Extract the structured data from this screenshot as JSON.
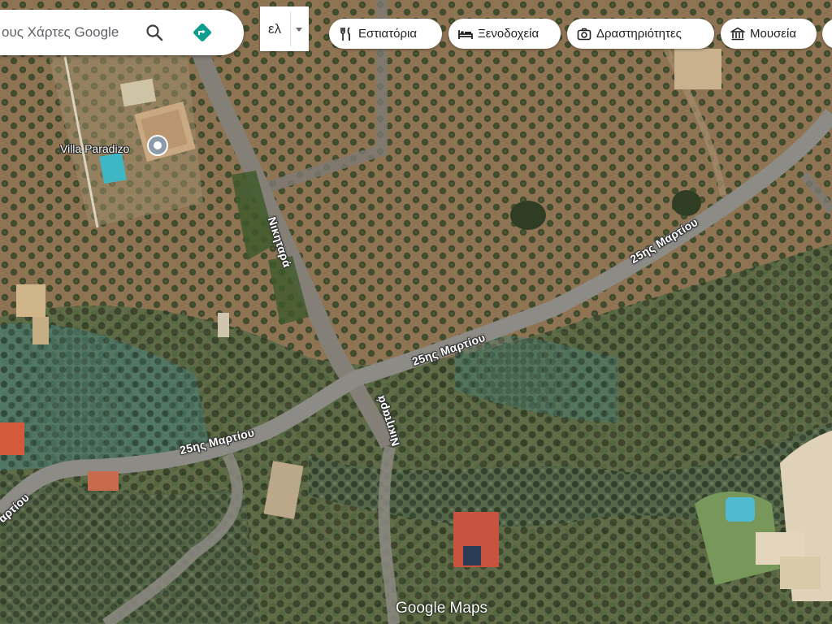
{
  "search": {
    "value": "ους Χάρτες Google",
    "search_icon": "search-icon",
    "directions_icon": "directions-icon"
  },
  "language": {
    "value": "ελ"
  },
  "chips": [
    {
      "label": "Εστιατόρια",
      "icon": "fork-knife-icon"
    },
    {
      "label": "Ξενοδοχεία",
      "icon": "bed-icon"
    },
    {
      "label": "Δραστηριότητες",
      "icon": "camera-icon"
    },
    {
      "label": "Μουσεία",
      "icon": "museum-icon"
    }
  ],
  "map": {
    "view": "satellite",
    "place": {
      "name": "Villa Paradizo"
    },
    "roads": {
      "marti_upper": "25ης Μαρτίου",
      "marti_middle": "25ης Μαρτίου",
      "marti_lower": "25ης Μαρτίου",
      "marti_edge": "αρτίου",
      "nikitara_north": "Νικηταρά",
      "nikitara_south": "Νικηταρά"
    },
    "logo": "Google Maps"
  },
  "colors": {
    "accent_teal": "#0f9d8e",
    "terrain": "#8a7050",
    "road": "#8d8b86"
  }
}
